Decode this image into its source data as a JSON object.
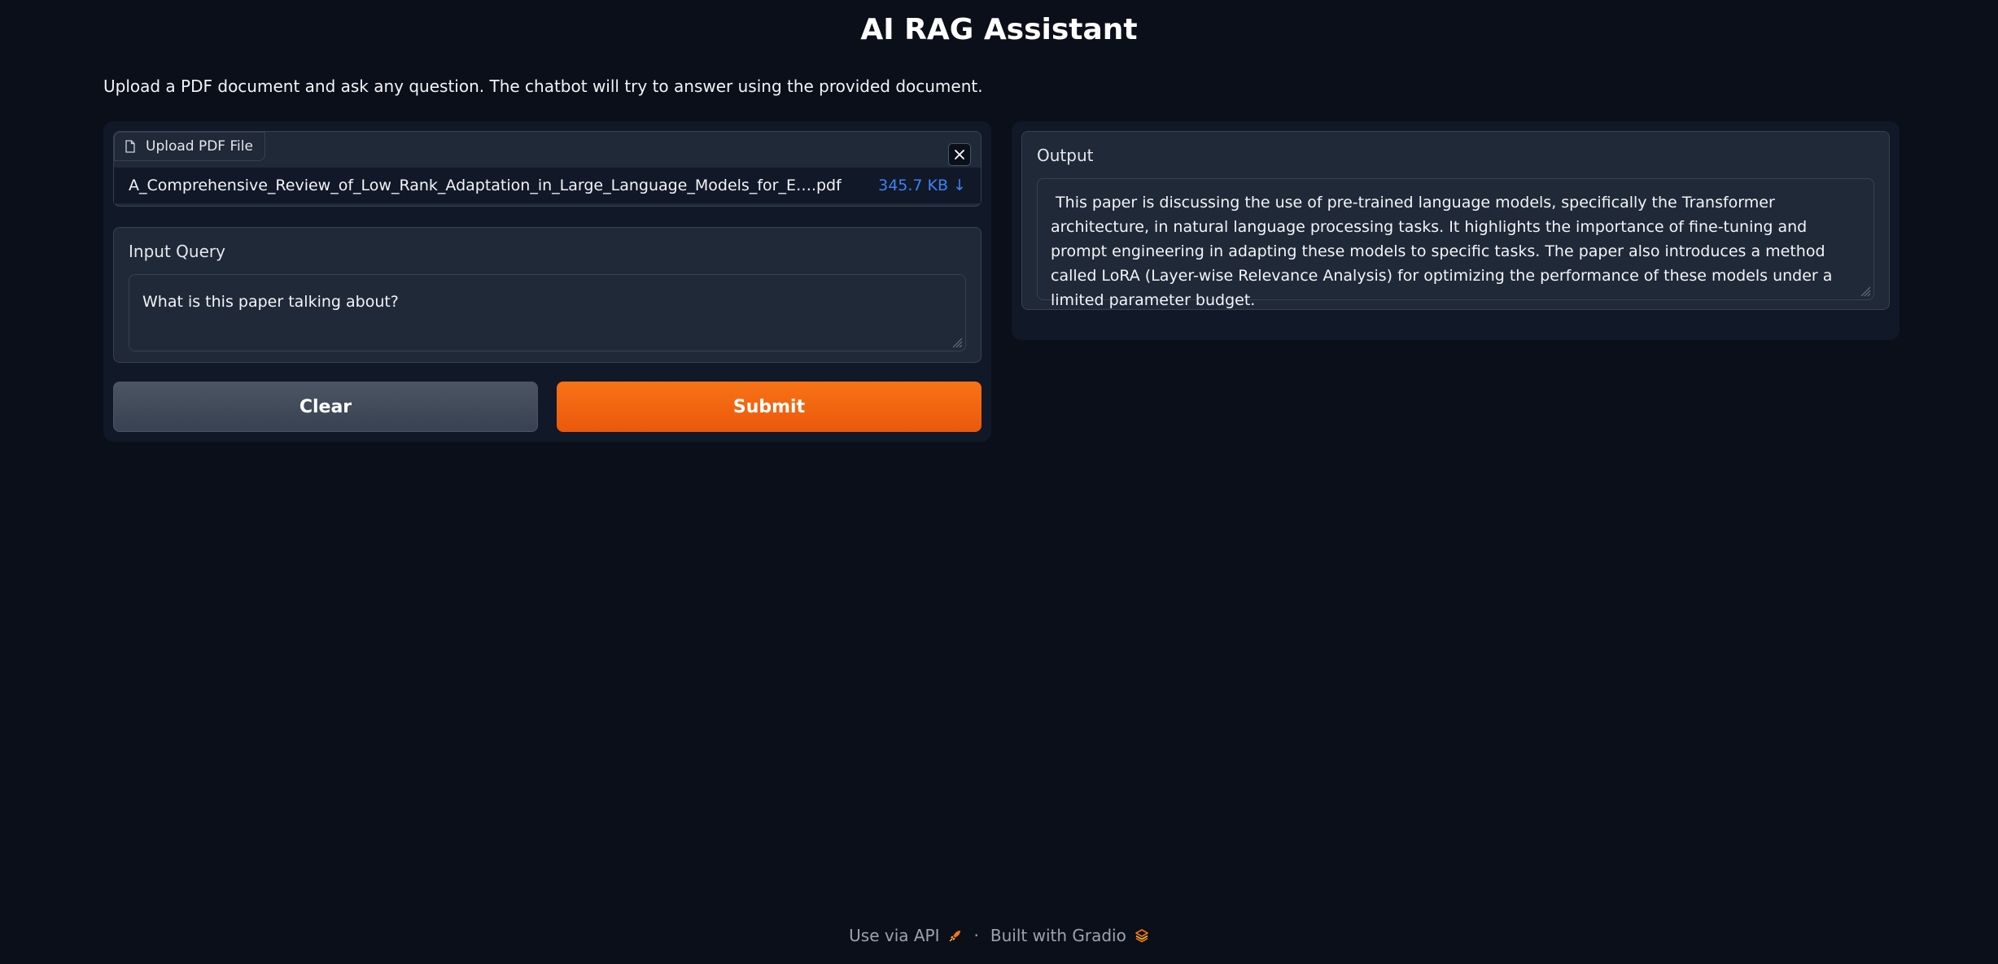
{
  "header": {
    "title": "AI RAG Assistant",
    "description": "Upload a PDF document and ask any question. The chatbot will try to answer using the provided document."
  },
  "file_upload": {
    "label": "Upload PDF File",
    "file_name": "A_Comprehensive_Review_of_Low_Rank_Adaptation_in_Large_Language_Models_for_E….pdf",
    "file_size": "345.7 KB ↓"
  },
  "query": {
    "label": "Input Query",
    "value": "What is this paper talking about?"
  },
  "buttons": {
    "clear_label": "Clear",
    "submit_label": "Submit"
  },
  "output": {
    "label": "Output",
    "value": " This paper is discussing the use of pre-trained language models, specifically the Transformer architecture, in natural language processing tasks. It highlights the importance of fine-tuning and prompt engineering in adapting these models to specific tasks. The paper also introduces a method called LoRA (Layer-wise Relevance Analysis) for optimizing the performance of these models under a limited parameter budget."
  },
  "footer": {
    "api_label": "Use via API",
    "separator": "·",
    "built_label": "Built with Gradio"
  },
  "colors": {
    "background": "#0b0f19",
    "accent": "#f97316",
    "link": "#3b82f6"
  }
}
